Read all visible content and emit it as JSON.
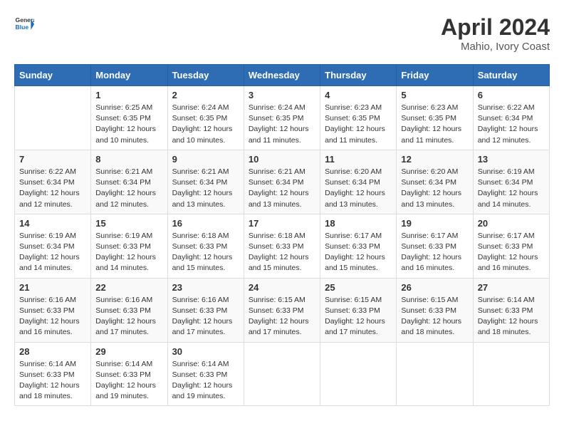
{
  "header": {
    "logo_line1": "General",
    "logo_line2": "Blue",
    "title": "April 2024",
    "location": "Mahio, Ivory Coast"
  },
  "weekdays": [
    "Sunday",
    "Monday",
    "Tuesday",
    "Wednesday",
    "Thursday",
    "Friday",
    "Saturday"
  ],
  "weeks": [
    [
      {
        "day": "",
        "sunrise": "",
        "sunset": "",
        "daylight": ""
      },
      {
        "day": "1",
        "sunrise": "Sunrise: 6:25 AM",
        "sunset": "Sunset: 6:35 PM",
        "daylight": "Daylight: 12 hours and 10 minutes."
      },
      {
        "day": "2",
        "sunrise": "Sunrise: 6:24 AM",
        "sunset": "Sunset: 6:35 PM",
        "daylight": "Daylight: 12 hours and 10 minutes."
      },
      {
        "day": "3",
        "sunrise": "Sunrise: 6:24 AM",
        "sunset": "Sunset: 6:35 PM",
        "daylight": "Daylight: 12 hours and 11 minutes."
      },
      {
        "day": "4",
        "sunrise": "Sunrise: 6:23 AM",
        "sunset": "Sunset: 6:35 PM",
        "daylight": "Daylight: 12 hours and 11 minutes."
      },
      {
        "day": "5",
        "sunrise": "Sunrise: 6:23 AM",
        "sunset": "Sunset: 6:35 PM",
        "daylight": "Daylight: 12 hours and 11 minutes."
      },
      {
        "day": "6",
        "sunrise": "Sunrise: 6:22 AM",
        "sunset": "Sunset: 6:34 PM",
        "daylight": "Daylight: 12 hours and 12 minutes."
      }
    ],
    [
      {
        "day": "7",
        "sunrise": "Sunrise: 6:22 AM",
        "sunset": "Sunset: 6:34 PM",
        "daylight": "Daylight: 12 hours and 12 minutes."
      },
      {
        "day": "8",
        "sunrise": "Sunrise: 6:21 AM",
        "sunset": "Sunset: 6:34 PM",
        "daylight": "Daylight: 12 hours and 12 minutes."
      },
      {
        "day": "9",
        "sunrise": "Sunrise: 6:21 AM",
        "sunset": "Sunset: 6:34 PM",
        "daylight": "Daylight: 12 hours and 13 minutes."
      },
      {
        "day": "10",
        "sunrise": "Sunrise: 6:21 AM",
        "sunset": "Sunset: 6:34 PM",
        "daylight": "Daylight: 12 hours and 13 minutes."
      },
      {
        "day": "11",
        "sunrise": "Sunrise: 6:20 AM",
        "sunset": "Sunset: 6:34 PM",
        "daylight": "Daylight: 12 hours and 13 minutes."
      },
      {
        "day": "12",
        "sunrise": "Sunrise: 6:20 AM",
        "sunset": "Sunset: 6:34 PM",
        "daylight": "Daylight: 12 hours and 13 minutes."
      },
      {
        "day": "13",
        "sunrise": "Sunrise: 6:19 AM",
        "sunset": "Sunset: 6:34 PM",
        "daylight": "Daylight: 12 hours and 14 minutes."
      }
    ],
    [
      {
        "day": "14",
        "sunrise": "Sunrise: 6:19 AM",
        "sunset": "Sunset: 6:34 PM",
        "daylight": "Daylight: 12 hours and 14 minutes."
      },
      {
        "day": "15",
        "sunrise": "Sunrise: 6:19 AM",
        "sunset": "Sunset: 6:33 PM",
        "daylight": "Daylight: 12 hours and 14 minutes."
      },
      {
        "day": "16",
        "sunrise": "Sunrise: 6:18 AM",
        "sunset": "Sunset: 6:33 PM",
        "daylight": "Daylight: 12 hours and 15 minutes."
      },
      {
        "day": "17",
        "sunrise": "Sunrise: 6:18 AM",
        "sunset": "Sunset: 6:33 PM",
        "daylight": "Daylight: 12 hours and 15 minutes."
      },
      {
        "day": "18",
        "sunrise": "Sunrise: 6:17 AM",
        "sunset": "Sunset: 6:33 PM",
        "daylight": "Daylight: 12 hours and 15 minutes."
      },
      {
        "day": "19",
        "sunrise": "Sunrise: 6:17 AM",
        "sunset": "Sunset: 6:33 PM",
        "daylight": "Daylight: 12 hours and 16 minutes."
      },
      {
        "day": "20",
        "sunrise": "Sunrise: 6:17 AM",
        "sunset": "Sunset: 6:33 PM",
        "daylight": "Daylight: 12 hours and 16 minutes."
      }
    ],
    [
      {
        "day": "21",
        "sunrise": "Sunrise: 6:16 AM",
        "sunset": "Sunset: 6:33 PM",
        "daylight": "Daylight: 12 hours and 16 minutes."
      },
      {
        "day": "22",
        "sunrise": "Sunrise: 6:16 AM",
        "sunset": "Sunset: 6:33 PM",
        "daylight": "Daylight: 12 hours and 17 minutes."
      },
      {
        "day": "23",
        "sunrise": "Sunrise: 6:16 AM",
        "sunset": "Sunset: 6:33 PM",
        "daylight": "Daylight: 12 hours and 17 minutes."
      },
      {
        "day": "24",
        "sunrise": "Sunrise: 6:15 AM",
        "sunset": "Sunset: 6:33 PM",
        "daylight": "Daylight: 12 hours and 17 minutes."
      },
      {
        "day": "25",
        "sunrise": "Sunrise: 6:15 AM",
        "sunset": "Sunset: 6:33 PM",
        "daylight": "Daylight: 12 hours and 17 minutes."
      },
      {
        "day": "26",
        "sunrise": "Sunrise: 6:15 AM",
        "sunset": "Sunset: 6:33 PM",
        "daylight": "Daylight: 12 hours and 18 minutes."
      },
      {
        "day": "27",
        "sunrise": "Sunrise: 6:14 AM",
        "sunset": "Sunset: 6:33 PM",
        "daylight": "Daylight: 12 hours and 18 minutes."
      }
    ],
    [
      {
        "day": "28",
        "sunrise": "Sunrise: 6:14 AM",
        "sunset": "Sunset: 6:33 PM",
        "daylight": "Daylight: 12 hours and 18 minutes."
      },
      {
        "day": "29",
        "sunrise": "Sunrise: 6:14 AM",
        "sunset": "Sunset: 6:33 PM",
        "daylight": "Daylight: 12 hours and 19 minutes."
      },
      {
        "day": "30",
        "sunrise": "Sunrise: 6:14 AM",
        "sunset": "Sunset: 6:33 PM",
        "daylight": "Daylight: 12 hours and 19 minutes."
      },
      {
        "day": "",
        "sunrise": "",
        "sunset": "",
        "daylight": ""
      },
      {
        "day": "",
        "sunrise": "",
        "sunset": "",
        "daylight": ""
      },
      {
        "day": "",
        "sunrise": "",
        "sunset": "",
        "daylight": ""
      },
      {
        "day": "",
        "sunrise": "",
        "sunset": "",
        "daylight": ""
      }
    ]
  ]
}
